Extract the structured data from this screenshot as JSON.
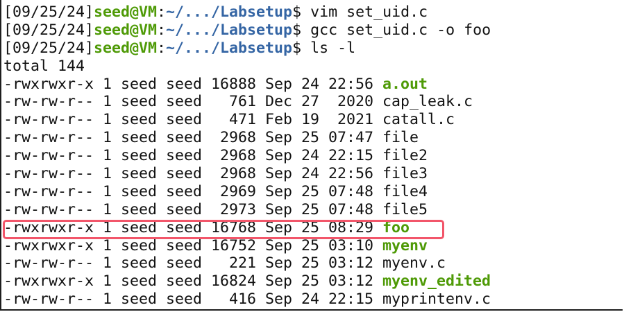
{
  "prompts": [
    {
      "time": "[09/25/24]",
      "user": "seed@VM",
      "sep": ":",
      "path": "~/.../Labsetup",
      "sym": "$ ",
      "cmd": "vim set_uid.c"
    },
    {
      "time": "[09/25/24]",
      "user": "seed@VM",
      "sep": ":",
      "path": "~/.../Labsetup",
      "sym": "$ ",
      "cmd": "gcc set_uid.c -o foo"
    },
    {
      "time": "[09/25/24]",
      "user": "seed@VM",
      "sep": ":",
      "path": "~/.../Labsetup",
      "sym": "$ ",
      "cmd": "ls -l"
    }
  ],
  "total": "total 144",
  "files": [
    {
      "meta": "-rwxrwxr-x 1 seed seed 16888 Sep 24 22:56 ",
      "name": "a.out",
      "exec": true
    },
    {
      "meta": "-rw-rw-r-- 1 seed seed   761 Dec 27  2020 ",
      "name": "cap_leak.c",
      "exec": false
    },
    {
      "meta": "-rw-rw-r-- 1 seed seed   471 Feb 19  2021 ",
      "name": "catall.c",
      "exec": false
    },
    {
      "meta": "-rw-rw-r-- 1 seed seed  2968 Sep 25 07:47 ",
      "name": "file",
      "exec": false
    },
    {
      "meta": "-rw-rw-r-- 1 seed seed  2968 Sep 24 22:15 ",
      "name": "file2",
      "exec": false
    },
    {
      "meta": "-rw-rw-r-- 1 seed seed  2968 Sep 24 22:56 ",
      "name": "file3",
      "exec": false
    },
    {
      "meta": "-rw-rw-r-- 1 seed seed  2969 Sep 25 07:48 ",
      "name": "file4",
      "exec": false
    },
    {
      "meta": "-rw-rw-r-- 1 seed seed  2973 Sep 25 07:48 ",
      "name": "file5",
      "exec": false
    },
    {
      "meta": "-rwxrwxr-x 1 seed seed 16768 Sep 25 08:29 ",
      "name": "foo",
      "exec": true
    },
    {
      "meta": "-rwxrwxr-x 1 seed seed 16752 Sep 25 03:10 ",
      "name": "myenv",
      "exec": true
    },
    {
      "meta": "-rw-rw-r-- 1 seed seed   221 Sep 25 03:12 ",
      "name": "myenv.c",
      "exec": false
    },
    {
      "meta": "-rwxrwxr-x 1 seed seed 16824 Sep 25 03:12 ",
      "name": "myenv_edited",
      "exec": true
    },
    {
      "meta": "-rw-rw-r-- 1 seed seed   416 Sep 24 22:15 ",
      "name": "myprintenv.c",
      "exec": false
    }
  ],
  "colors": {
    "exec": "#4e9a06",
    "path": "#3465a4",
    "highlight": "#f2566a"
  }
}
